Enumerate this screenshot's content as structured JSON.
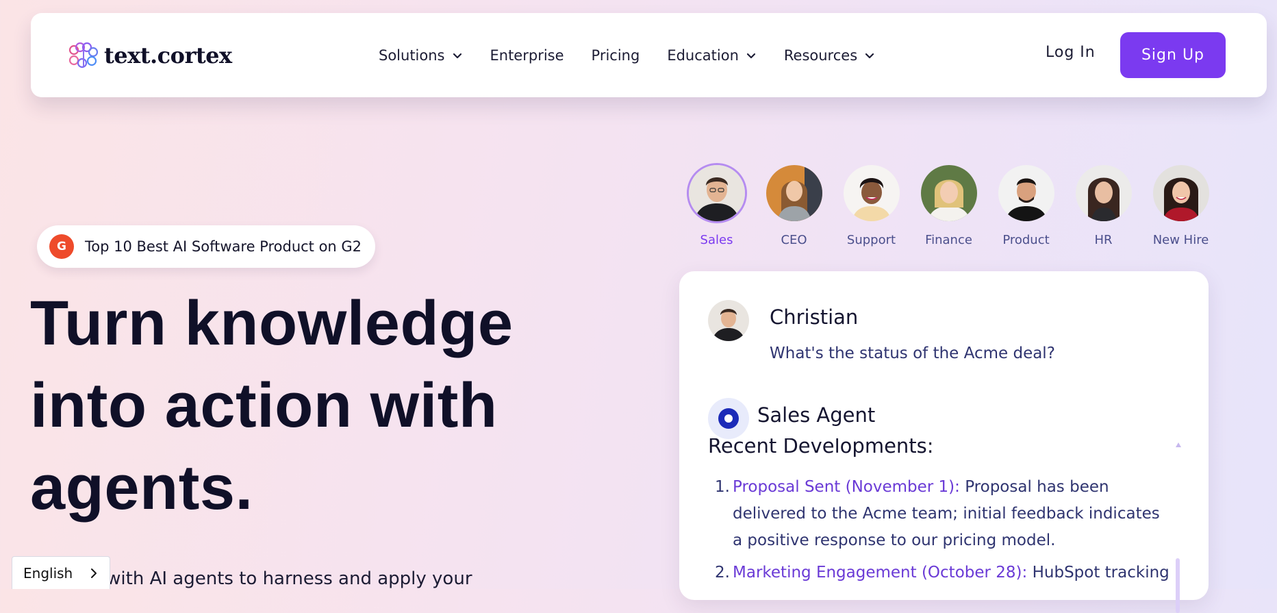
{
  "header": {
    "logo_text": "text.cortex",
    "nav_items": [
      {
        "label": "Solutions",
        "has_dropdown": true
      },
      {
        "label": "Enterprise",
        "has_dropdown": false
      },
      {
        "label": "Pricing",
        "has_dropdown": false
      },
      {
        "label": "Education",
        "has_dropdown": true
      },
      {
        "label": "Resources",
        "has_dropdown": true
      }
    ],
    "login_label": "Log In",
    "signup_label": "Sign Up"
  },
  "hero": {
    "badge_icon": "G",
    "badge_text": "Top 10 Best AI Software Product on G2",
    "headline_lines": [
      "Turn knowledge",
      "into action with",
      "agents."
    ],
    "subtext": "ur team with AI agents to harness and apply your"
  },
  "language": {
    "label": "English"
  },
  "agents": [
    {
      "label": "Sales",
      "active": true
    },
    {
      "label": "CEO",
      "active": false
    },
    {
      "label": "Support",
      "active": false
    },
    {
      "label": "Finance",
      "active": false
    },
    {
      "label": "Product",
      "active": false
    },
    {
      "label": "HR",
      "active": false
    },
    {
      "label": "New Hire",
      "active": false
    }
  ],
  "chat": {
    "user_name": "Christian",
    "user_question": "What's the status of the Acme deal?",
    "agent_name": "Sales Agent",
    "heading": "Recent Developments:",
    "items": [
      {
        "number": "1.",
        "highlight": "Proposal Sent (November 1):",
        "lines": [
          "Proposal has been delivered",
          "to the Acme team; initial feedback indicates a positive",
          "response to our pricing model."
        ]
      },
      {
        "number": "2.",
        "highlight": "Marketing Engagement (October 28):",
        "lines": [
          "HubSpot tracking"
        ]
      }
    ]
  },
  "colors": {
    "brand_purple": "#7b3af0",
    "link_purple": "#6a3ad6",
    "text_navy": "#2f3470",
    "g2_red": "#ee4b2b"
  }
}
